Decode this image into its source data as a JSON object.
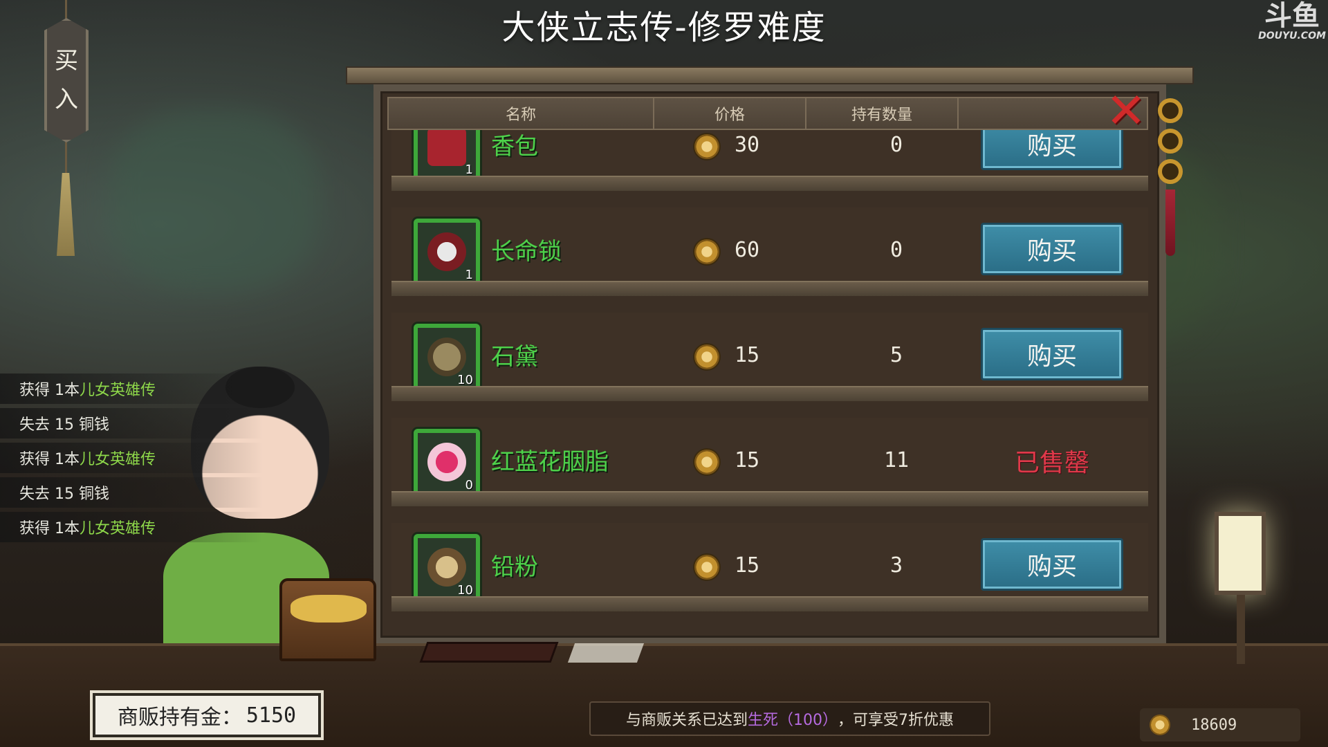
{
  "title": "大侠立志传-修罗难度",
  "watermark": {
    "logo": "斗鱼",
    "site": "DOUYU.COM"
  },
  "side_sign": {
    "char1": "买",
    "char2": "入"
  },
  "table": {
    "headers": [
      "名称",
      "价格",
      "持有数量",
      ""
    ]
  },
  "items": [
    {
      "name": "香包",
      "icon": "sachet-icon",
      "stack": "1",
      "price": "30",
      "owned": "0",
      "action": "购买",
      "sold_out": false
    },
    {
      "name": "长命锁",
      "icon": "longevity-lock-icon",
      "stack": "1",
      "price": "60",
      "owned": "0",
      "action": "购买",
      "sold_out": false
    },
    {
      "name": "石黛",
      "icon": "stone-eyebrow-ink-icon",
      "stack": "10",
      "price": "15",
      "owned": "5",
      "action": "购买",
      "sold_out": false
    },
    {
      "name": "红蓝花胭脂",
      "icon": "rouge-icon",
      "stack": "0",
      "price": "15",
      "owned": "11",
      "action": "已售罄",
      "sold_out": true
    },
    {
      "name": "铅粉",
      "icon": "lead-powder-icon",
      "stack": "10",
      "price": "15",
      "owned": "3",
      "action": "购买",
      "sold_out": false
    }
  ],
  "log": [
    {
      "prefix": "获得 1本",
      "highlight": "儿女英雄传"
    },
    {
      "prefix": "失去 15 铜钱",
      "highlight": ""
    },
    {
      "prefix": "获得 1本",
      "highlight": "儿女英雄传"
    },
    {
      "prefix": "失去 15 铜钱",
      "highlight": ""
    },
    {
      "prefix": "获得 1本",
      "highlight": "儿女英雄传"
    }
  ],
  "merchant": {
    "label": "商贩持有金：",
    "gold": "5150"
  },
  "relation": {
    "before": "与商贩关系已达到",
    "level": "生死（100）",
    "after": "，可享受7折优惠"
  },
  "player": {
    "gold": "18609"
  },
  "colors": {
    "item_name": "#4ed14a",
    "buy_button": "#3f8ea8",
    "sold_out": "#e0394a",
    "relation_level": "#b66be0"
  }
}
